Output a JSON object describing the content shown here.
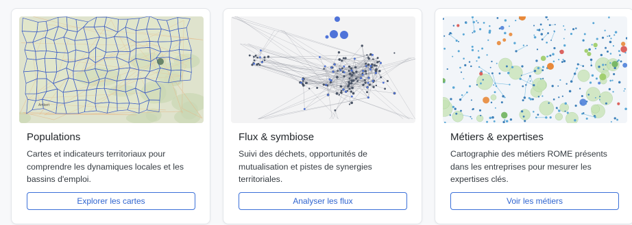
{
  "cards": [
    {
      "title": "Populations",
      "description": "Cartes et indicateurs territoriaux pour comprendre les dynamiques locales et les bassins d'emploi.",
      "button_label": "Explorer les cartes",
      "image_icon": "map-thumbnail"
    },
    {
      "title": "Flux & symbiose",
      "description": "Suivi des déchets, opportunités de mutualisation et pistes de synergies territoriales.",
      "button_label": "Analyser les flux",
      "image_icon": "network-graph-thumbnail"
    },
    {
      "title": "Métiers & expertises",
      "description": "Cartographie des métiers ROME présents dans les entreprises pour mesurer les expertises clés.",
      "button_label": "Voir les métiers",
      "image_icon": "occupations-graph-thumbnail"
    }
  ],
  "map_labels": [
    "Ambert"
  ],
  "colors": {
    "accent": "#3a6fd8",
    "map_border": "#3b5cc4",
    "map_ground": "#dfe3cd",
    "network_node": "#4f73d9",
    "network_bg": "#f3f3f4"
  }
}
